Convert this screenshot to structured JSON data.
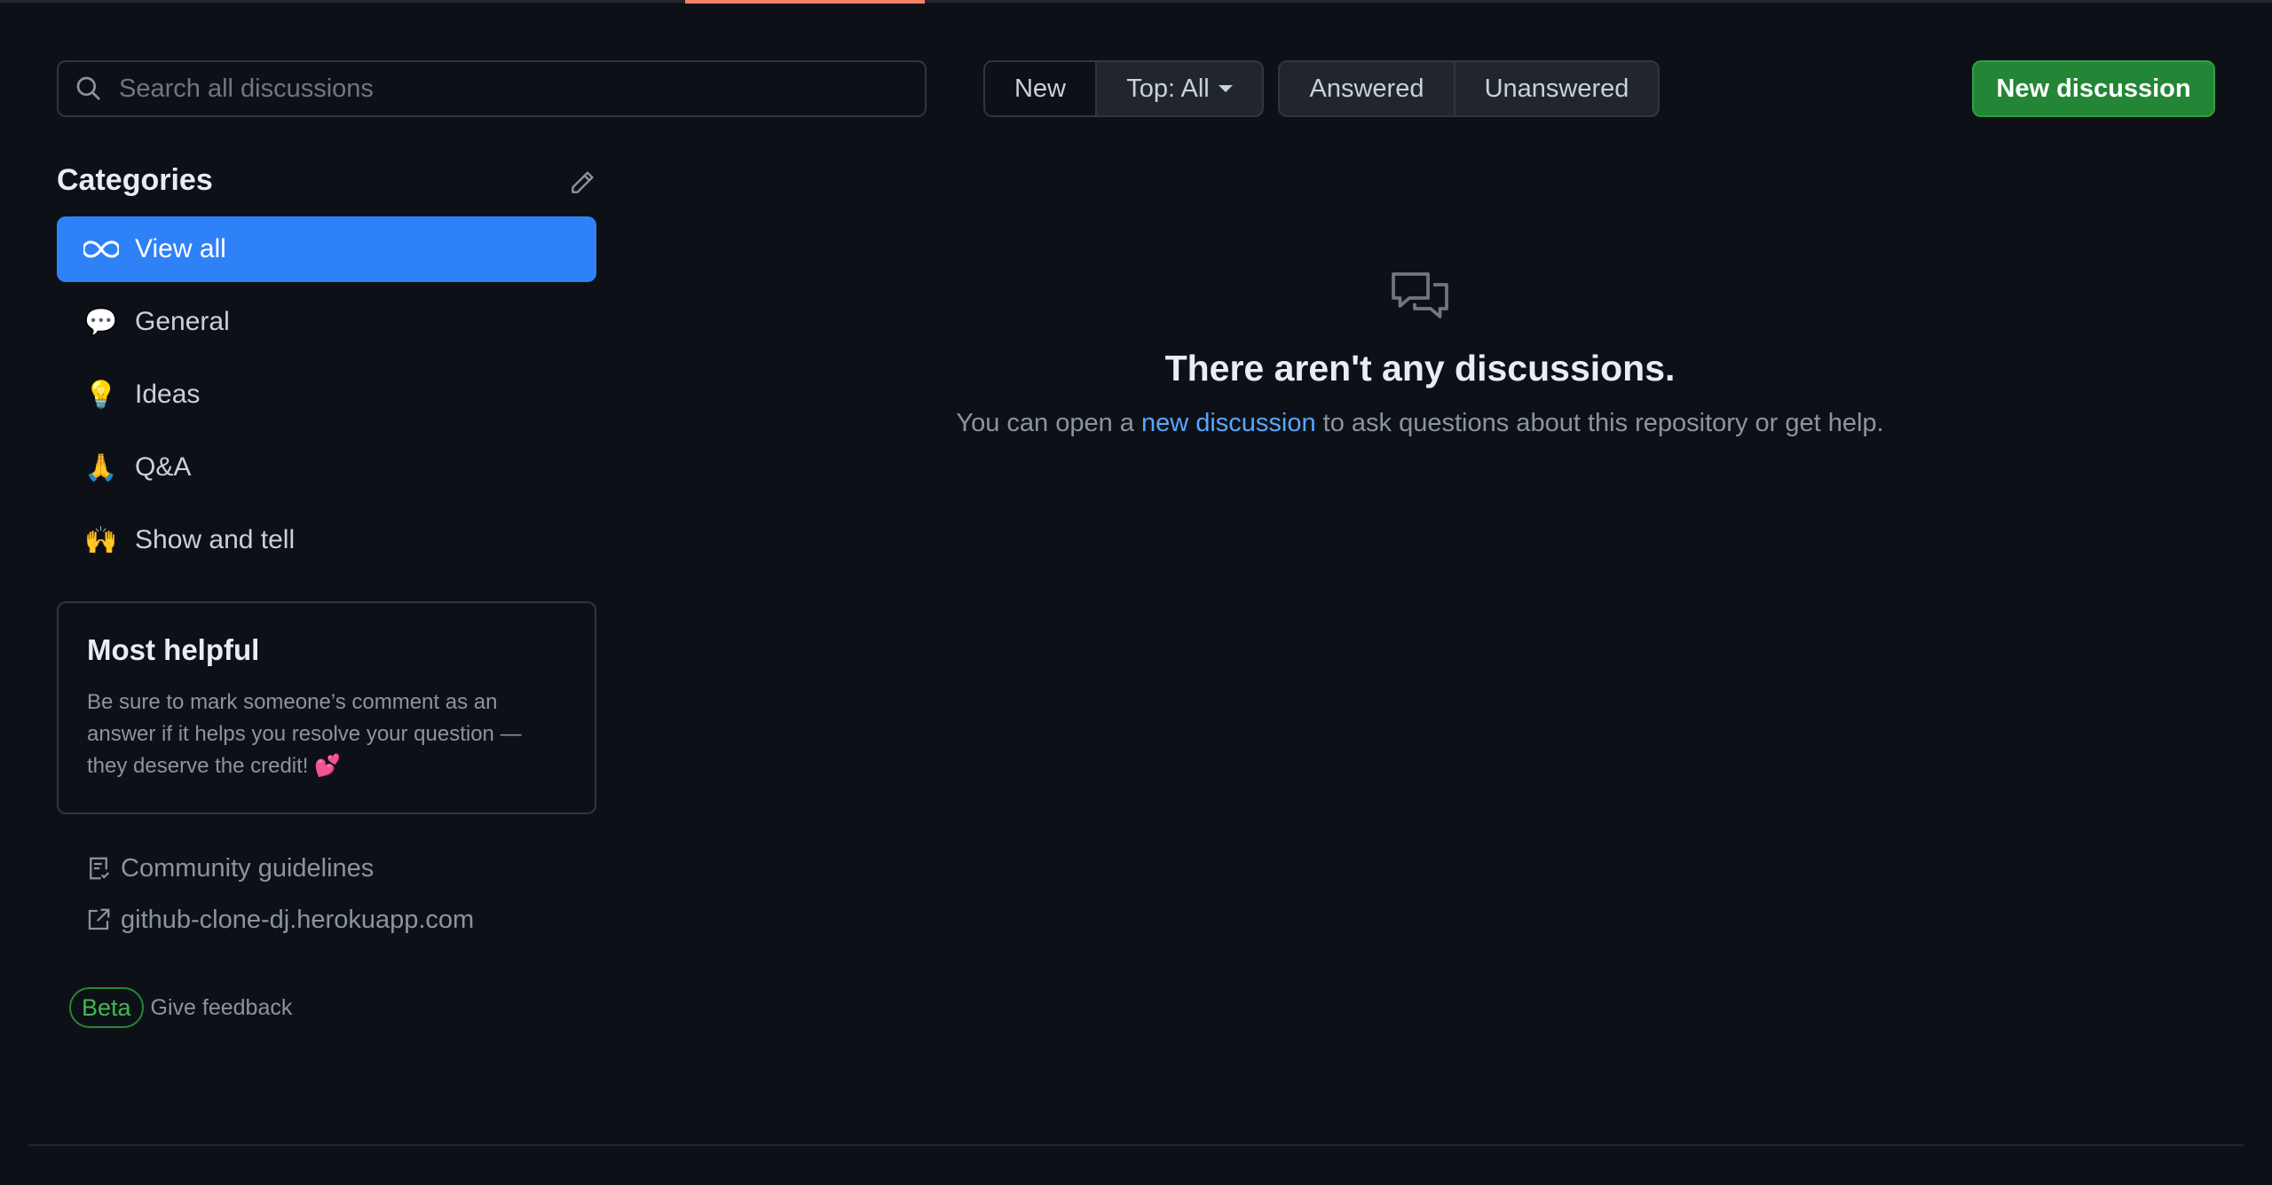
{
  "search": {
    "placeholder": "Search all discussions"
  },
  "sort_group": {
    "new_label": "New",
    "top_label": "Top: All"
  },
  "filter_group": {
    "answered_label": "Answered",
    "unanswered_label": "Unanswered"
  },
  "new_discussion_button": "New discussion",
  "sidebar": {
    "categories_title": "Categories",
    "categories": [
      {
        "label": "View all",
        "icon": "infinity-icon",
        "selected": true
      },
      {
        "label": "General",
        "icon": "speech-bubble-icon",
        "emoji": "💬"
      },
      {
        "label": "Ideas",
        "icon": "light-bulb-icon",
        "emoji": "💡"
      },
      {
        "label": "Q&A",
        "icon": "folded-hands-icon",
        "emoji": "🙏"
      },
      {
        "label": "Show and tell",
        "icon": "raised-hands-icon",
        "emoji": "🙌"
      }
    ],
    "most_helpful": {
      "title": "Most helpful",
      "body": "Be sure to mark someone’s comment as an answer if it helps you resolve your question — they deserve the credit! 💕"
    },
    "links": [
      {
        "label": "Community guidelines",
        "icon": "checklist-icon"
      },
      {
        "label": "github-clone-dj.herokuapp.com",
        "icon": "external-link-icon"
      }
    ],
    "beta_badge": "Beta",
    "give_feedback": "Give feedback"
  },
  "empty_state": {
    "heading": "There aren't any discussions.",
    "text_before": "You can open a ",
    "link_text": "new discussion",
    "text_after": " to ask questions about this repository or get help."
  },
  "colors": {
    "background": "#0d1117",
    "accent_blue": "#2f81f7",
    "primary_green": "#238636",
    "link": "#58a6ff",
    "tab_underline": "#f78166"
  }
}
